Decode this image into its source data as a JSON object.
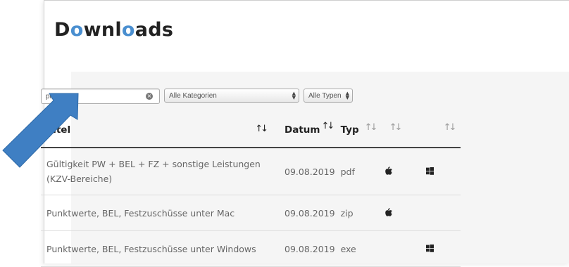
{
  "page": {
    "heading_prefix": "D",
    "heading_o1": "o",
    "heading_mid": "wnl",
    "heading_o2": "o",
    "heading_suffix": "ads"
  },
  "filters": {
    "search_value": "punktwert",
    "category_value": "Alle Kategorien",
    "type_value": "Alle Typen"
  },
  "table": {
    "headers": {
      "title": "Titel",
      "date": "Datum",
      "type": "Typ"
    },
    "rows": [
      {
        "title_line1": "Gültigkeit PW + BEL + FZ + sonstige Leistungen",
        "title_line2": "(KZV-Bereiche)",
        "date": "09.08.2019",
        "type": "pdf",
        "mac": true,
        "win": true
      },
      {
        "title_line1": "Punktwerte, BEL, Festzuschüsse unter Mac",
        "title_line2": "",
        "date": "09.08.2019",
        "type": "zip",
        "mac": true,
        "win": false
      },
      {
        "title_line1": "Punktwerte, BEL, Festzuschüsse unter Windows",
        "title_line2": "",
        "date": "09.08.2019",
        "type": "exe",
        "mac": false,
        "win": true
      }
    ]
  },
  "colors": {
    "accent": "#4a8fd0",
    "arrow": "#3f7fc3"
  },
  "icons": [
    "clear-icon",
    "select-arrows-icon",
    "sort-icon",
    "apple-icon",
    "windows-icon",
    "pointer-arrow"
  ]
}
